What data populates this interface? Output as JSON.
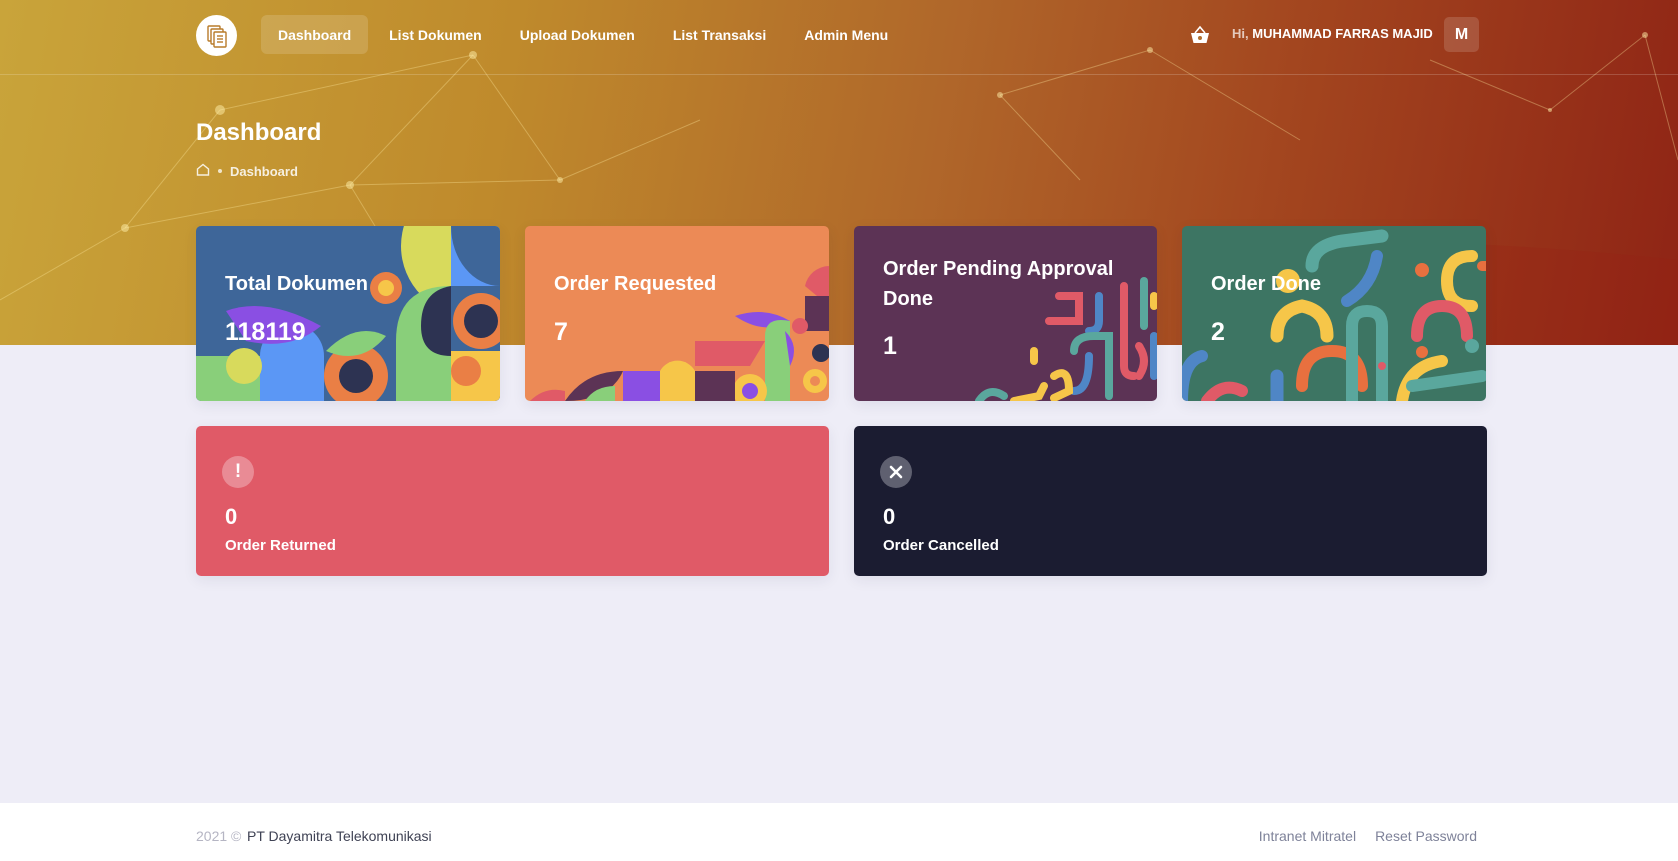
{
  "header": {
    "nav": [
      {
        "label": "Dashboard",
        "active": true
      },
      {
        "label": "List Dokumen",
        "active": false
      },
      {
        "label": "Upload Dokumen",
        "active": false
      },
      {
        "label": "List Transaksi",
        "active": false
      },
      {
        "label": "Admin Menu",
        "active": false
      }
    ],
    "greeting_prefix": "Hi,",
    "user_name": "MUHAMMAD FARRAS MAJID",
    "avatar_initial": "M",
    "logo_icon": "documents-icon",
    "cart_icon": "basket-icon"
  },
  "page": {
    "title": "Dashboard",
    "breadcrumb": [
      "Dashboard"
    ],
    "home_icon": "home-icon"
  },
  "stats": [
    {
      "label": "Total Dokumen",
      "value": "118119",
      "color": "#3e6699"
    },
    {
      "label": "Order Requested",
      "value": "7",
      "color": "#ec8a56"
    },
    {
      "label": "Order Pending Approval Done",
      "value": "1",
      "color": "#5c3355"
    },
    {
      "label": "Order Done",
      "value": "2",
      "color": "#3d7563"
    }
  ],
  "status_cards": [
    {
      "label": "Order Returned",
      "value": "0",
      "icon": "exclamation-icon",
      "color": "#e05a67"
    },
    {
      "label": "Order Cancelled",
      "value": "0",
      "icon": "close-icon",
      "color": "#1b1c31"
    }
  ],
  "footer": {
    "year": "2021 ©",
    "company": "PT Dayamitra Telekomunikasi",
    "links": [
      "Intranet Mitratel",
      "Reset Password"
    ]
  }
}
